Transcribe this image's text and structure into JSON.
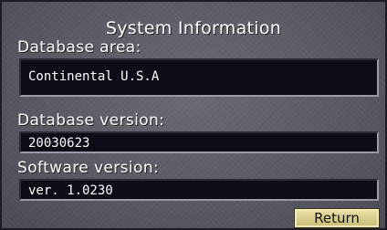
{
  "title": "System Information",
  "fields": [
    {
      "label": "Database area:",
      "value": "Continental U.S.A"
    },
    {
      "label": "Database version:",
      "value": "20030623"
    },
    {
      "label": "Software version:",
      "value": "ver. 1.0230"
    }
  ],
  "buttons": {
    "return_label": "Return"
  }
}
